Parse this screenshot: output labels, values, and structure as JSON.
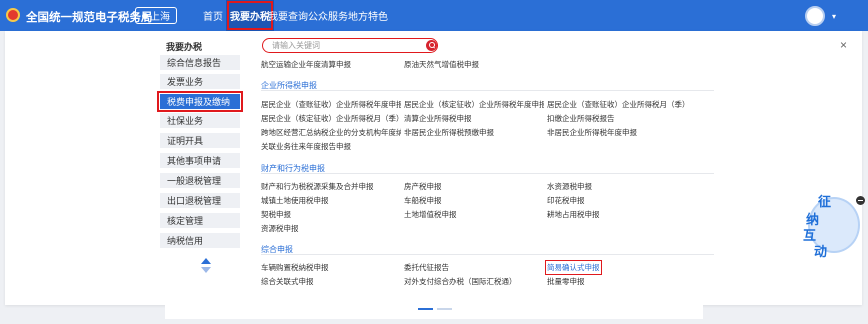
{
  "header": {
    "site_title": "全国统一规范电子税务局",
    "region": "上海",
    "nav": [
      "首页",
      "我要办税",
      "我要查询",
      "公众服务",
      "地方特色"
    ],
    "active_nav": "我要办税"
  },
  "sidebar": {
    "heading": "我要办税",
    "items": [
      "综合信息报告",
      "发票业务",
      "税费申报及缴纳",
      "社保业务",
      "证明开具",
      "其他事项申请",
      "一般退税管理",
      "出口退税管理",
      "核定管理",
      "纳税信用"
    ],
    "active_item": "税费申报及缴纳"
  },
  "search": {
    "placeholder": "请输入关键词"
  },
  "top_links": [
    "航空运输企业年度清算申报",
    "原油天然气增值税申报"
  ],
  "sections": [
    {
      "title": "企业所得税申报",
      "links": [
        "居民企业（查账征收）企业所得税年度申报",
        "居民企业（核定征收）企业所得税年度申报",
        "居民企业（查账征收）企业所得税月（季）度...",
        "居民企业（核定征收）企业所得税月（季）度...",
        "清算企业所得税申报",
        "扣缴企业所得税报告",
        "跨地区经营汇总纳税企业的分支机构年度纳税...",
        "非居民企业所得税预缴申报",
        "非居民企业所得税年度申报",
        "关联业务往来年度报告申报"
      ]
    },
    {
      "title": "财产和行为税申报",
      "links": [
        "财产和行为税税源采集及合并申报",
        "房产税申报",
        "水资源税申报",
        "城镇土地使用税申报",
        "车船税申报",
        "印花税申报",
        "契税申报",
        "土地增值税申报",
        "耕地占用税申报",
        "资源税申报"
      ]
    },
    {
      "title": "综合申报",
      "links": [
        "车辆购置税纳税申报",
        "委托代征报告",
        "简易确认式申报",
        "综合关联式申报",
        "对外支付综合办税（国际汇税通）",
        "批量零申报"
      ],
      "highlighted": "简易确认式申报"
    }
  ],
  "widget": {
    "chars": [
      "征",
      "纳",
      "互",
      "动"
    ]
  },
  "colors": {
    "brand_blue": "#2b6fd6",
    "highlight_red": "#e0191d"
  }
}
